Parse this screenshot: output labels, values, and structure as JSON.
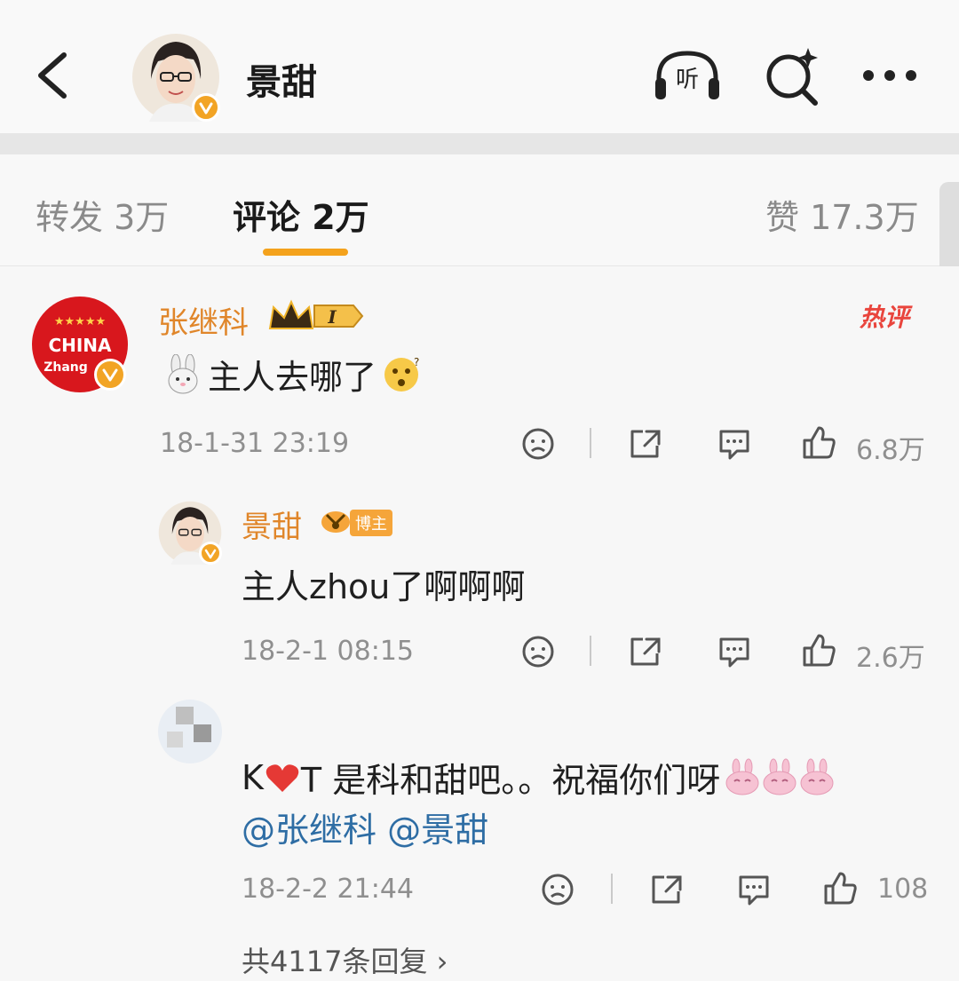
{
  "header": {
    "title": "景甜",
    "listen_label": "听"
  },
  "tabs": {
    "repost": "转发 3万",
    "comments": "评论 2万",
    "likes": "赞 17.3万"
  },
  "comments": [
    {
      "author": "张继科",
      "avatar_text_top": "CHINA",
      "avatar_text_bottom": "Zhang",
      "level_badge": "I",
      "hot_badge": "热评",
      "text": "主人去哪了",
      "time": "18-1-31 23:19",
      "likes": "6.8万"
    },
    {
      "author": "景甜",
      "role_badge": "博主",
      "text": "主人zhou了啊啊啊",
      "time": "18-2-1 08:15",
      "likes": "2.6万"
    },
    {
      "author": "",
      "text_before_heart": "K",
      "text_after_heart": "T 是科和甜吧。。祝福你们呀",
      "mentions": "@张继科 @景甜",
      "time": "18-2-2 21:44",
      "likes": "108"
    }
  ],
  "more_replies": "共4117条回复 ›",
  "colors": {
    "accent": "#f4a21c",
    "username": "#e0862a",
    "hot": "#e9453d",
    "verified": "#f2a425"
  },
  "icons": [
    "back-icon",
    "listen-icon",
    "search-icon",
    "more-icon",
    "dislike-icon",
    "share-icon",
    "reply-icon",
    "like-icon",
    "verified-icon",
    "crown-icon",
    "rabbit-emoji",
    "thinking-emoji",
    "heart-emoji",
    "pink-rabbit-emoji"
  ]
}
